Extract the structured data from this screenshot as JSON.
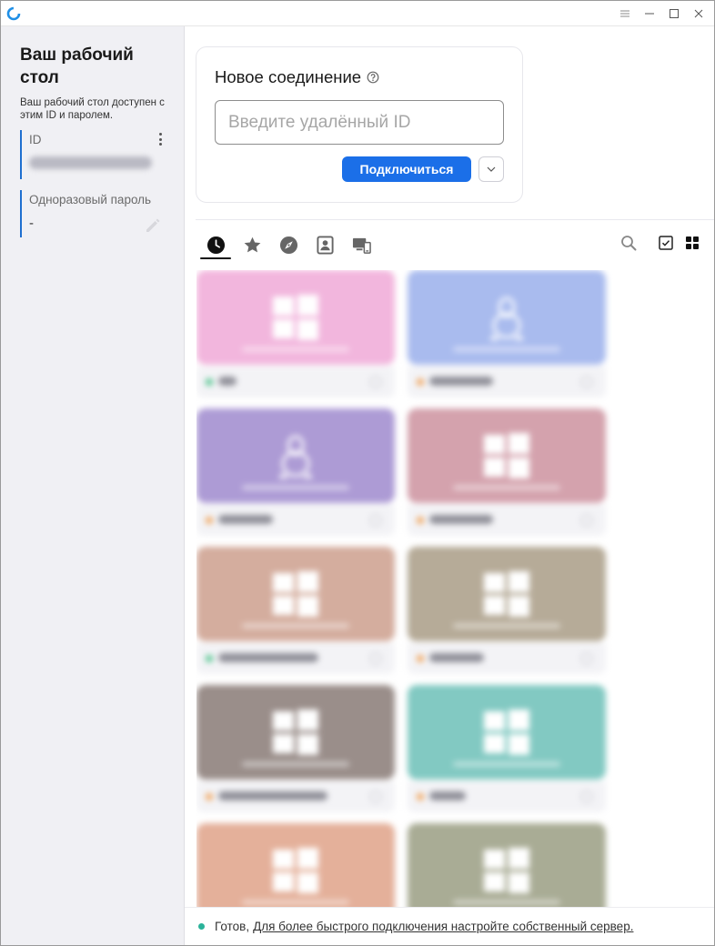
{
  "titlebar": {
    "icons": [
      "rustdesk-logo-icon",
      "menu-icon",
      "minimize-icon",
      "maximize-icon",
      "close-icon"
    ],
    "accent": "#1b6fe8"
  },
  "sidebar": {
    "title": "Ваш рабочий стол",
    "description": "Ваш рабочий стол доступен с этим ID и паролем.",
    "id_label": "ID",
    "id_value": "",
    "password_label": "Одноразовый пароль",
    "password_value": "-"
  },
  "connection": {
    "title": "Новое соединение",
    "input_placeholder": "Введите удалённый ID",
    "input_value": "",
    "connect_label": "Подключиться"
  },
  "tabs": [
    {
      "id": "recent",
      "icon": "clock-icon",
      "active": true
    },
    {
      "id": "favorites",
      "icon": "star-icon",
      "active": false
    },
    {
      "id": "discovered",
      "icon": "compass-icon",
      "active": false
    },
    {
      "id": "address-book",
      "icon": "contact-book-icon",
      "active": false
    },
    {
      "id": "group",
      "icon": "devices-icon",
      "active": false
    }
  ],
  "view_tools": [
    "search-icon",
    "select-checkbox-icon",
    "grid-view-icon"
  ],
  "peers": [
    {
      "color": "#f2b6dd",
      "os": "windows",
      "status": "#4cc38a"
    },
    {
      "color": "#a9bbee",
      "os": "linux",
      "status": "#f0a35a"
    },
    {
      "color": "#ad9bd5",
      "os": "linux",
      "status": "#f0a35a"
    },
    {
      "color": "#d4a2ad",
      "os": "windows",
      "status": "#f0a35a"
    },
    {
      "color": "#d4ad9e",
      "os": "windows",
      "status": "#4cc38a"
    },
    {
      "color": "#b6ab98",
      "os": "windows",
      "status": "#f0a35a"
    },
    {
      "color": "#9a8e8a",
      "os": "windows",
      "status": "#f0a35a"
    },
    {
      "color": "#82c9c2",
      "os": "windows",
      "status": "#f0a35a"
    },
    {
      "color": "#e4b09a",
      "os": "windows",
      "status": "#f0a35a"
    },
    {
      "color": "#a9ac95",
      "os": "windows",
      "status": "#f0a35a"
    }
  ],
  "status": {
    "text": "Готов,",
    "link": "Для более быстрого подключения настройте собственный сервер.",
    "color": "#2bb39a"
  }
}
